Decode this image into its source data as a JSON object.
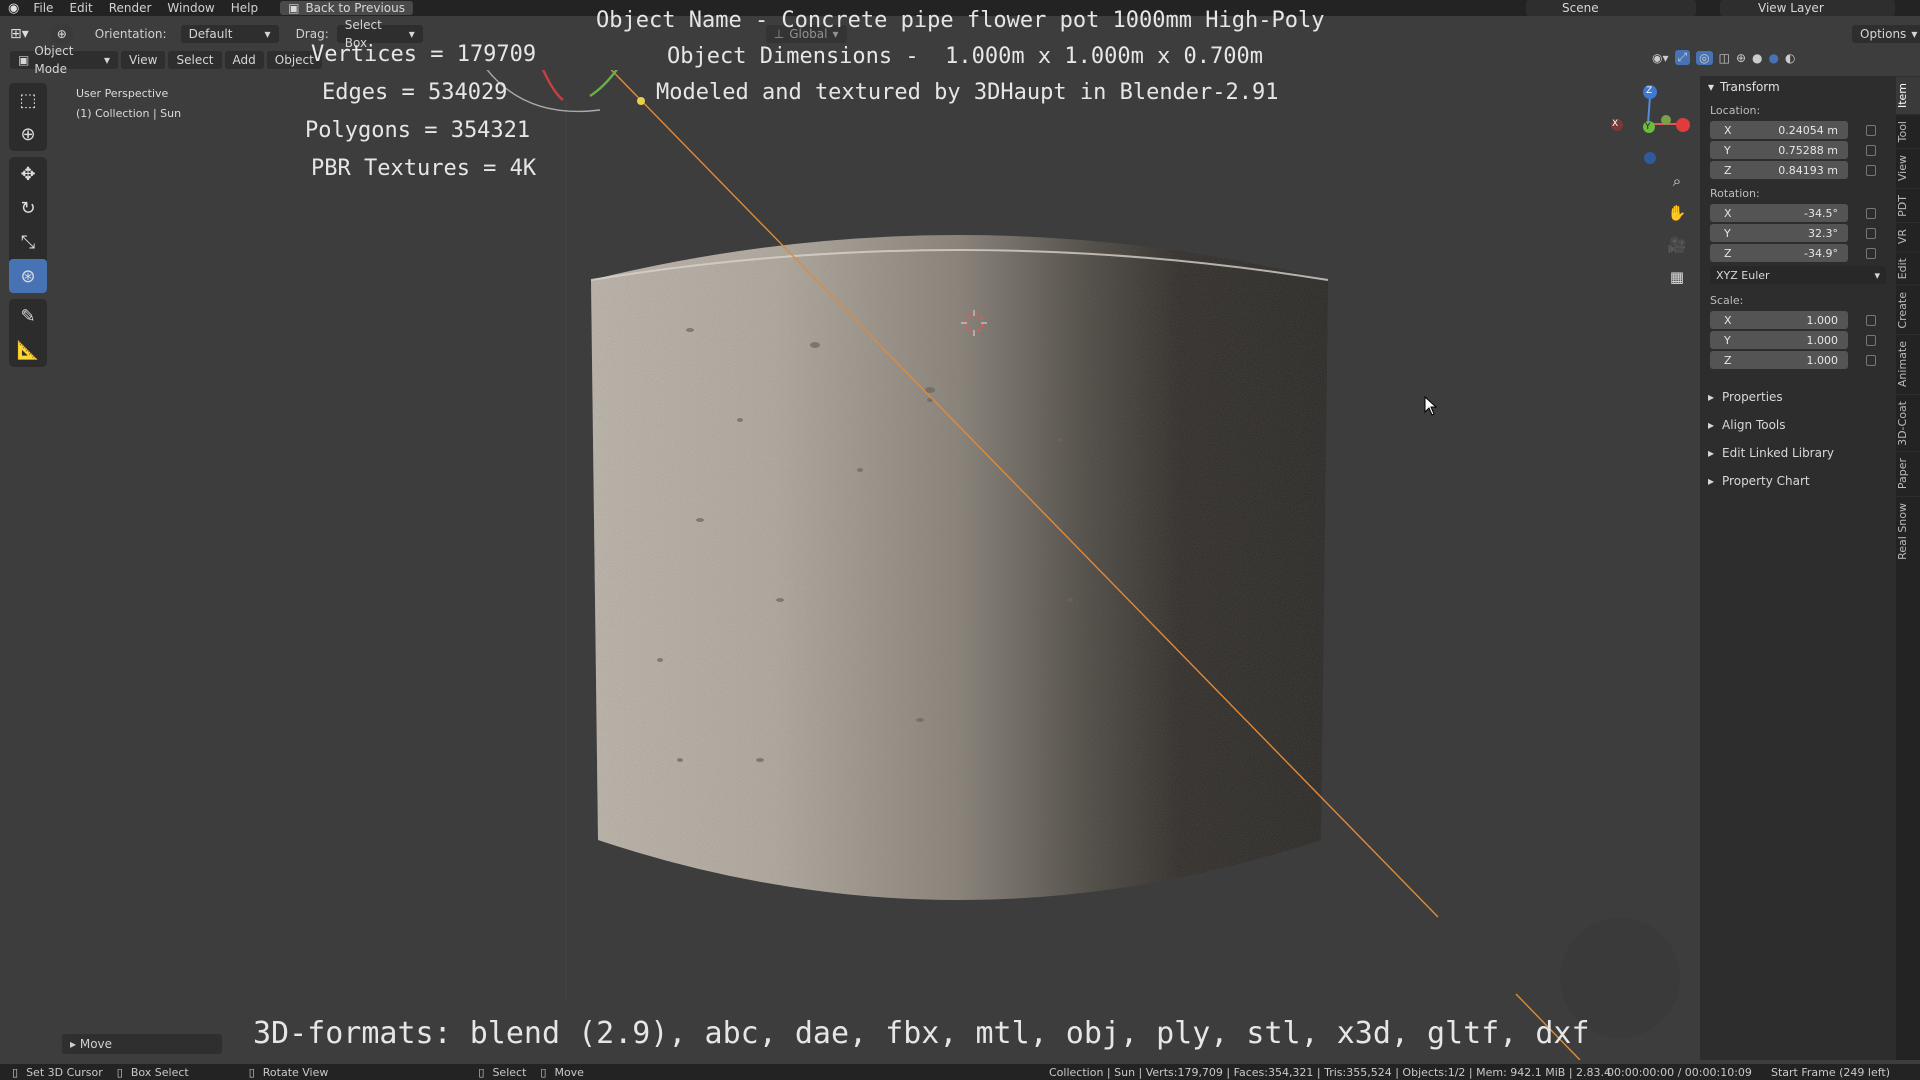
{
  "menu": {
    "items": [
      "File",
      "Edit",
      "Render",
      "Window",
      "Help"
    ],
    "back_button": "Back to Previous",
    "scene": "Scene",
    "view_layer": "View Layer"
  },
  "header": {
    "orientation_label": "Orientation:",
    "orientation_value": "Default",
    "drag_label": "Drag:",
    "drag_value": "Select Box",
    "transform_orientation": "Global",
    "options": "Options"
  },
  "viewport_header": {
    "mode": "Object Mode",
    "menus": [
      "View",
      "Select",
      "Add",
      "Object"
    ]
  },
  "viewport_info": {
    "perspective": "User Perspective",
    "collection": "(1) Collection | Sun"
  },
  "overlay": {
    "object_name": "Object Name - Concrete pipe flower pot 1000mm High-Poly",
    "dimensions": "Object Dimensions -  1.000m x 1.000m x 0.700m",
    "credit": "Modeled and textured by 3DHaupt in Blender-2.91",
    "vertices": "Vertices = 179709",
    "edges": "Edges = 534029",
    "polygons": "Polygons = 354321",
    "textures": "PBR Textures = 4K",
    "formats": "3D-formats: blend (2.9), abc, dae, fbx, mtl, obj, ply, stl, x3d, gltf, dxf"
  },
  "npanel": {
    "transform_title": "Transform",
    "location_label": "Location:",
    "location": [
      {
        "axis": "X",
        "value": "0.24054 m"
      },
      {
        "axis": "Y",
        "value": "0.75288 m"
      },
      {
        "axis": "Z",
        "value": "0.84193 m"
      }
    ],
    "rotation_label": "Rotation:",
    "rotation": [
      {
        "axis": "X",
        "value": "-34.5°"
      },
      {
        "axis": "Y",
        "value": "32.3°"
      },
      {
        "axis": "Z",
        "value": "-34.9°"
      }
    ],
    "rotation_mode": "XYZ Euler",
    "scale_label": "Scale:",
    "scale": [
      {
        "axis": "X",
        "value": "1.000"
      },
      {
        "axis": "Y",
        "value": "1.000"
      },
      {
        "axis": "Z",
        "value": "1.000"
      }
    ],
    "panels": [
      "Properties",
      "Align Tools",
      "Edit Linked Library",
      "Property Chart"
    ]
  },
  "side_tabs": [
    "Item",
    "Tool",
    "View",
    "PDT",
    "VR",
    "Edit",
    "Create",
    "Animate",
    "3D-Coat",
    "Paper",
    "Real Snow"
  ],
  "gizmo": {
    "x": "X",
    "y": "Y",
    "z": "Z"
  },
  "last_operator": "Move",
  "statusbar": {
    "left": [
      {
        "icon": "mouse-left-icon",
        "label": "Set 3D Cursor"
      },
      {
        "icon": "mouse-drag-icon",
        "label": "Box Select"
      },
      {
        "icon": "mouse-middle-icon",
        "label": "Rotate View"
      },
      {
        "icon": "mouse-left-icon",
        "label": "Select"
      },
      {
        "icon": "mouse-drag-icon",
        "label": "Move"
      }
    ],
    "stats": "Collection | Sun | Verts:179,709 | Faces:354,321 | Tris:355,524 | Objects:1/2 | Mem: 942.1 MiB | 2.83.4",
    "time": "00:00:00:00 / 00:00:10:09",
    "frame": "Start Frame (249 left)"
  },
  "colors": {
    "accent": "#4772b3",
    "light_line": "#f0a040",
    "viewport_bg": "#3d3d3d"
  }
}
